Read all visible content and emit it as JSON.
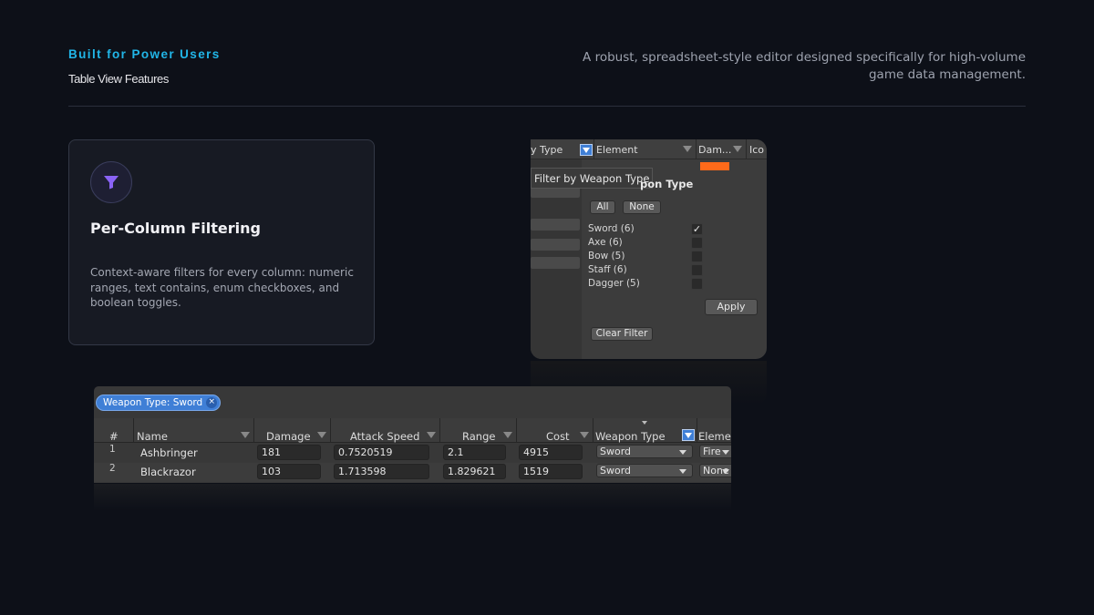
{
  "header": {
    "eyebrow": "Built for Power Users",
    "subtitle": "Table View Features",
    "tagline": "A robust, spreadsheet-style editor designed specifically for high-volume game data management."
  },
  "card": {
    "icon": "filter-funnel-icon",
    "title": "Per-Column Filtering",
    "text": "Context-aware filters for every column: numeric ranges, text contains, enum checkboxes, and boolean toggles."
  },
  "filter_popup": {
    "header_cols": [
      "y Type",
      "Element",
      "Dam...",
      "Ico"
    ],
    "tooltip": "Filter by Weapon Type",
    "title": "pon Type",
    "all_label": "All",
    "none_label": "None",
    "options": [
      {
        "label": "Sword (6)",
        "checked": true
      },
      {
        "label": "Axe (6)",
        "checked": false
      },
      {
        "label": "Bow (5)",
        "checked": false
      },
      {
        "label": "Staff (6)",
        "checked": false
      },
      {
        "label": "Dagger (5)",
        "checked": false
      }
    ],
    "apply_label": "Apply",
    "clear_label": "Clear Filter",
    "swatch_color": "#ff6a1a"
  },
  "table": {
    "chip": "Weapon Type: Sword",
    "chip_close": "×",
    "columns": [
      "#",
      "Name",
      "Damage",
      "Attack Speed",
      "Range",
      "Cost",
      "Weapon Type",
      "Elemen"
    ],
    "rows": [
      {
        "num": "1",
        "name": "Ashbringer",
        "damage": "181",
        "speed": "0.7520519",
        "range": "2.1",
        "cost": "4915",
        "type": "Sword",
        "element": "Fire"
      },
      {
        "num": "2",
        "name": "Blackrazor",
        "damage": "103",
        "speed": "1.713598",
        "range": "1.829621",
        "cost": "1519",
        "type": "Sword",
        "element": "None"
      }
    ],
    "accent": "#3f7fd6"
  }
}
